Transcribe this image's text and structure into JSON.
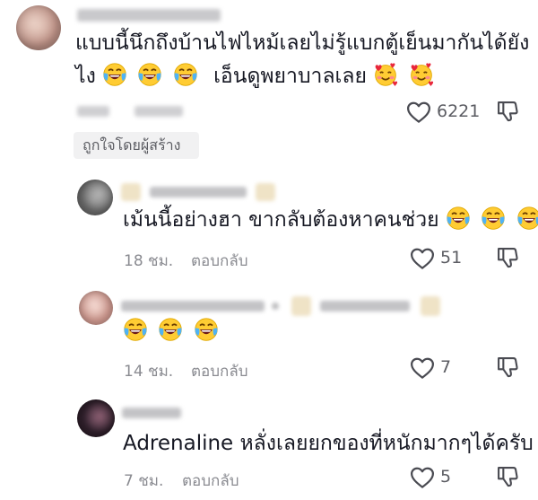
{
  "comments": [
    {
      "text_line1": "แบบนี้นึกถึงบ้านไฟไหม้เลยไม่รู้แบกตู้เย็นมากันได้ยัง",
      "text_line2": "ไง",
      "text_line2_after": "เอ็นดูพยาบาลเลย",
      "likes": "6221",
      "creator_badge": "ถูกใจโดยผู้สร้าง"
    },
    {
      "text": "เม้นนี้อย่างฮา ขากลับต้องหาคนช่วย",
      "time": "18 ชม.",
      "reply_label": "ตอบกลับ",
      "likes": "51"
    },
    {
      "time": "14 ชม.",
      "reply_label": "ตอบกลับ",
      "likes": "7"
    },
    {
      "text": "Adrenaline หลั่งเลยยกของที่หนักมากๆได้ครับ",
      "time": "7 ชม.",
      "reply_label": "ตอบกลับ",
      "likes": "5"
    }
  ],
  "icons": {
    "laugh": "face-with-tears-of-joy-icon",
    "hearts": "smiling-face-with-hearts-icon",
    "like": "heart-outline-icon",
    "dislike": "thumbs-down-icon"
  },
  "colors": {
    "text": "#161823",
    "meta": "#8a8b91",
    "badge_bg": "#f1f1f2",
    "emoji_face": "#FFCC33"
  }
}
